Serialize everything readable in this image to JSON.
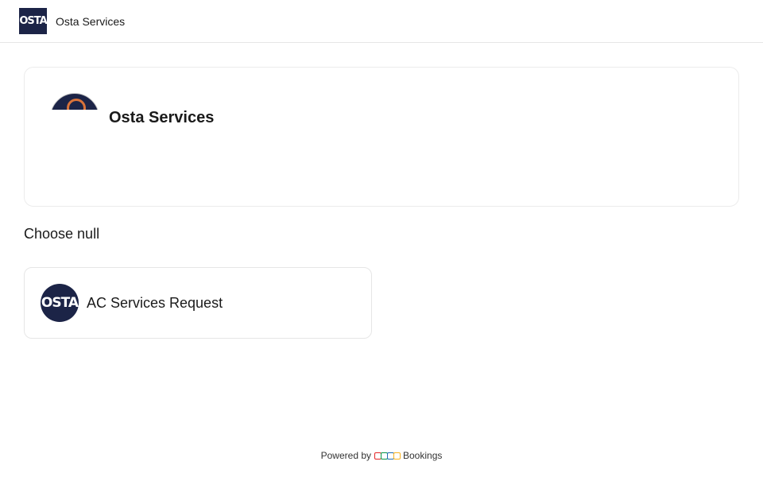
{
  "header": {
    "logo_text": "OSTA",
    "title": "Osta Services"
  },
  "profile": {
    "name": "Osta Services",
    "avatar_icon": "business-logo"
  },
  "section": {
    "heading": "Choose null"
  },
  "services": [
    {
      "name": "AC Services Request",
      "logo_text": "OSTA"
    }
  ],
  "footer": {
    "powered_by": "Powered by",
    "brand": "Bookings",
    "logo_colors": [
      "#e42527",
      "#089949",
      "#226db4",
      "#f9b21d"
    ]
  },
  "colors": {
    "brand_navy": "#1c2447",
    "accent_orange": "#d9733a"
  }
}
